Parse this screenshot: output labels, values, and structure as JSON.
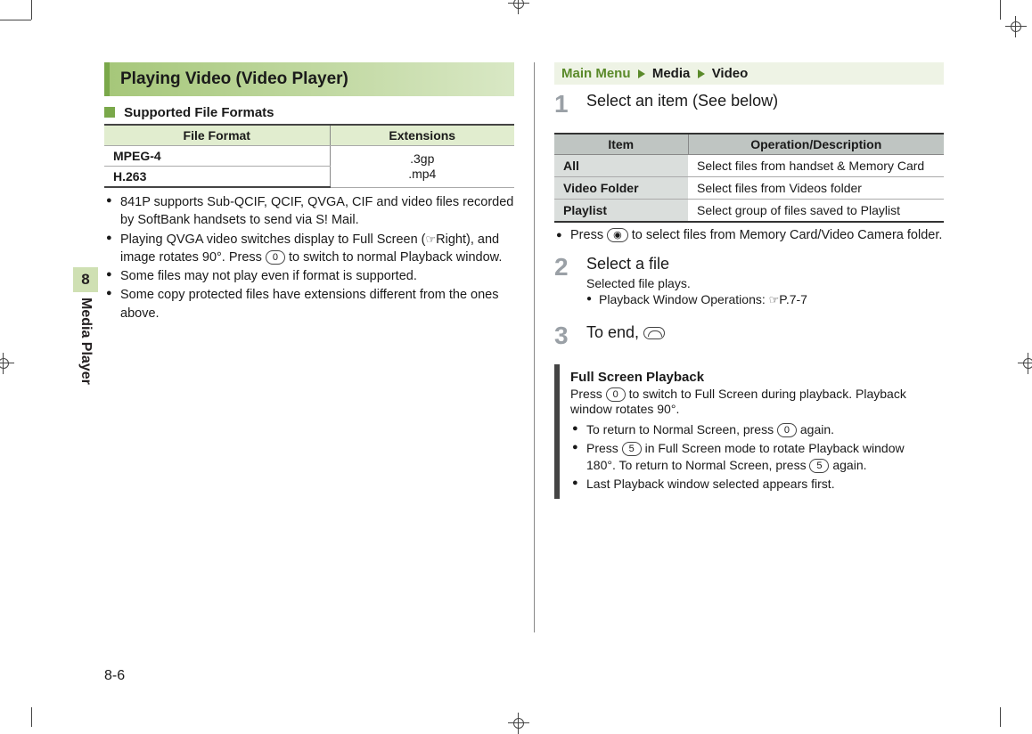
{
  "sideTab": {
    "num": "8",
    "label": "Media Player"
  },
  "pageNumber": "8-6",
  "left": {
    "title": "Playing Video (Video Player)",
    "subhead": "Supported File Formats",
    "table": {
      "headers": [
        "File Format",
        "Extensions"
      ],
      "rows": [
        {
          "fmt": "MPEG-4",
          "ext": ".3gp"
        },
        {
          "fmt": "H.263",
          "ext": ".mp4"
        }
      ]
    },
    "bul1": "841P supports Sub-QCIF, QCIF, QVGA, CIF and video files recorded by SoftBank handsets to send via S! Mail.",
    "bul2a": "Playing QVGA video switches display to Full Screen (",
    "bul2b": "Right), and image rotates 90°. Press ",
    "bul2c": " to switch to normal Playback window.",
    "bul3": "Some files may not play even if format is supported.",
    "bul4": "Some copy protected files have extensions different from the ones above."
  },
  "right": {
    "bc": {
      "mm": "Main Menu",
      "a": "Media",
      "b": "Video"
    },
    "step1": "Select an item (See below)",
    "table": {
      "headers": [
        "Item",
        "Operation/Description"
      ],
      "rows": [
        {
          "a": "All",
          "b": "Select files from handset & Memory Card"
        },
        {
          "a": "Video Folder",
          "b": "Select files from Videos folder"
        },
        {
          "a": "Playlist",
          "b": "Select group of files saved to Playlist"
        }
      ]
    },
    "noteA": "Press ",
    "noteB": " to select files from Memory Card/Video Camera folder.",
    "step2": "Select a file",
    "step2sub": "Selected file plays.",
    "step2sub2a": "Playback Window Operations: ",
    "step2sub2b": "P.7-7",
    "step3": "To end, ",
    "panel": {
      "title": "Full Screen Playback",
      "p1a": "Press ",
      "p1b": " to switch to Full Screen during playback. Playback window rotates 90°.",
      "b1a": "To return to Normal Screen, press ",
      "b1b": " again.",
      "b2a": "Press ",
      "b2b": " in Full Screen mode to rotate Playback window 180°. To return to Normal Screen, press ",
      "b2c": " again.",
      "b3": "Last Playback window selected appears first."
    },
    "keys": {
      "zero": "0",
      "five": "5",
      "cam": "◉"
    },
    "pointer": "☞"
  }
}
